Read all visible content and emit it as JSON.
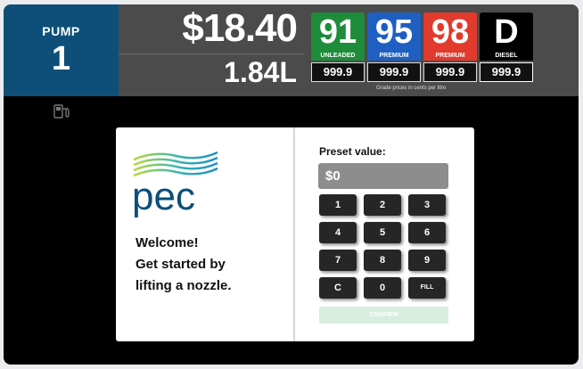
{
  "header": {
    "pump_label": "PUMP",
    "pump_number": "1",
    "amount": "$18.40",
    "volume": "1.84L"
  },
  "grades": [
    {
      "code": "91",
      "name": "UNLEADED",
      "price": "999.9",
      "color": "#1e8c3a"
    },
    {
      "code": "95",
      "name": "PREMIUM",
      "price": "999.9",
      "color": "#1f5fc2"
    },
    {
      "code": "98",
      "name": "PREMIUM",
      "price": "999.9",
      "color": "#e23a2c"
    },
    {
      "code": "D",
      "name": "DIESEL",
      "price": "999.9",
      "color": "#000000"
    }
  ],
  "grades_note": "Grade prices in cents per litre",
  "welcome": {
    "line1": "Welcome!",
    "line2": "Get started by",
    "line3": "lifting a nozzle."
  },
  "logo_text": "pec",
  "preset": {
    "label": "Preset value:",
    "value": "$0"
  },
  "keypad": {
    "keys": [
      "1",
      "2",
      "3",
      "4",
      "5",
      "6",
      "7",
      "8",
      "9",
      "C",
      "0",
      "FILL"
    ],
    "confirm": "CONFIRM"
  },
  "colors": {
    "pump_blue": "#0d4f78",
    "header_gray": "#4b4b4b",
    "logo_blue": "#0b4e7a"
  }
}
